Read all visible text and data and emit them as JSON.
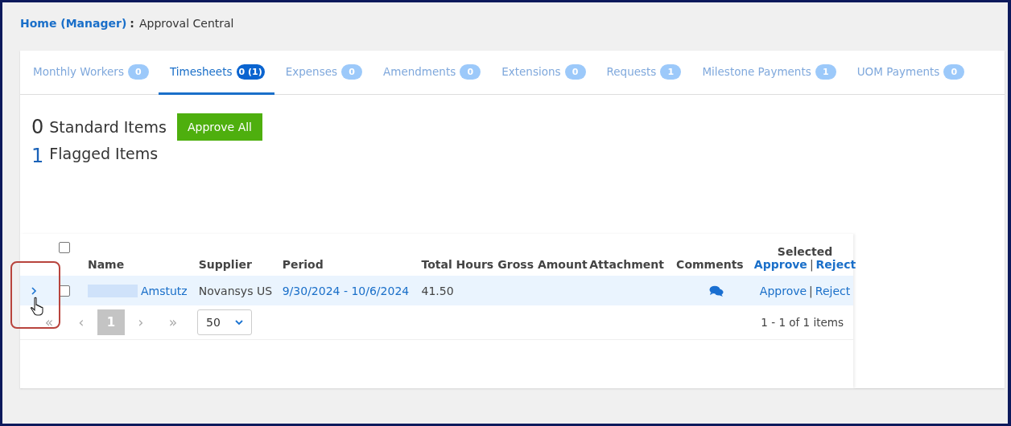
{
  "breadcrumb": {
    "home": "Home (Manager)",
    "separator": ":",
    "current": "Approval Central"
  },
  "tabs": [
    {
      "label": "Monthly Workers",
      "count": "0",
      "selected": false
    },
    {
      "label": "Timesheets",
      "count": "0 (1)",
      "selected": true
    },
    {
      "label": "Expenses",
      "count": "0",
      "selected": false
    },
    {
      "label": "Amendments",
      "count": "0",
      "selected": false
    },
    {
      "label": "Extensions",
      "count": "0",
      "selected": false
    },
    {
      "label": "Requests",
      "count": "1",
      "selected": false
    },
    {
      "label": "Milestone Payments",
      "count": "1",
      "selected": false
    },
    {
      "label": "UOM Payments",
      "count": "0",
      "selected": false
    }
  ],
  "summary": {
    "standard_count": "0",
    "standard_label": "Standard Items",
    "approve_all": "Approve All",
    "flagged_count": "1",
    "flagged_label": "Flagged Items"
  },
  "table": {
    "select_all_checked": false,
    "columns": [
      "Name",
      "Supplier",
      "Period",
      "Total Hours",
      "Gross Amount",
      "Attachment",
      "Comments"
    ],
    "selected_header": {
      "title": "Selected",
      "approve": "Approve",
      "separator": "|",
      "reject": "Reject"
    },
    "rows": [
      {
        "expanded": false,
        "checked": false,
        "name": "Amstutz",
        "supplier": "Novansys US",
        "period": "9/30/2024 - 10/6/2024",
        "total_hours": "41.50",
        "approve": "Approve",
        "separator": "|",
        "reject": "Reject"
      }
    ]
  },
  "pager": {
    "first": "«",
    "prev": "‹",
    "pages": [
      {
        "label": "1",
        "selected": true
      }
    ],
    "next": "›",
    "last": "»",
    "page_size": "50",
    "summary": "1 - 1 of 1 items"
  }
}
